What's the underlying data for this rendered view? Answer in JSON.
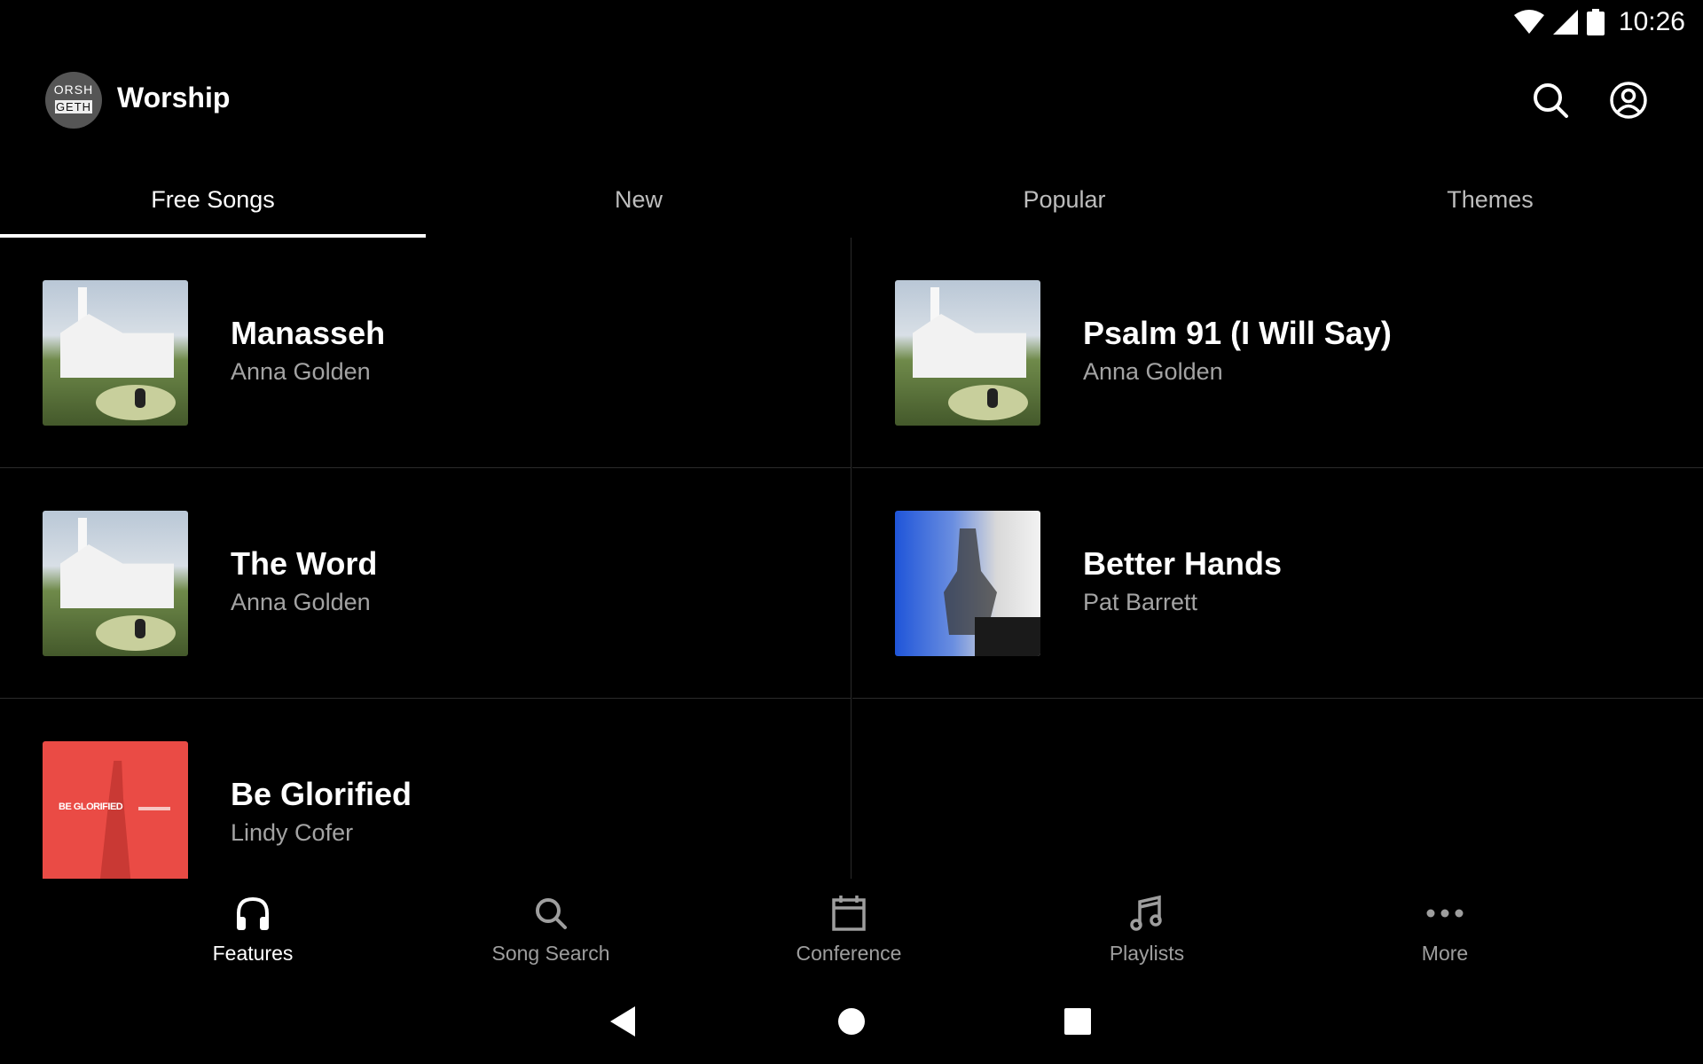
{
  "status_bar": {
    "time": "10:26"
  },
  "header": {
    "logo_line1": "ORSH",
    "logo_line2": "GETH",
    "title": "Worship"
  },
  "tabs": [
    {
      "label": "Free Songs",
      "active": true
    },
    {
      "label": "New",
      "active": false
    },
    {
      "label": "Popular",
      "active": false
    },
    {
      "label": "Themes",
      "active": false
    }
  ],
  "songs": [
    {
      "title": "Manasseh",
      "artist": "Anna Golden"
    },
    {
      "title": "Psalm 91 (I Will Say)",
      "artist": "Anna Golden"
    },
    {
      "title": "The Word",
      "artist": "Anna Golden"
    },
    {
      "title": "Better Hands",
      "artist": "Pat Barrett"
    },
    {
      "title": "Be Glorified",
      "artist": "Lindy Cofer",
      "art_text": "BE GLORIFIED"
    }
  ],
  "bottom_nav": [
    {
      "label": "Features",
      "icon": "headphones-icon",
      "active": true
    },
    {
      "label": "Song Search",
      "icon": "search-icon",
      "active": false
    },
    {
      "label": "Conference",
      "icon": "calendar-icon",
      "active": false
    },
    {
      "label": "Playlists",
      "icon": "music-note-icon",
      "active": false
    },
    {
      "label": "More",
      "icon": "more-horizontal-icon",
      "active": false
    }
  ]
}
